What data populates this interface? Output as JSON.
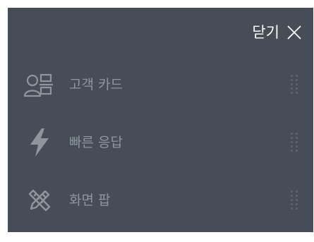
{
  "header": {
    "close_label": "닫기"
  },
  "menu": {
    "items": [
      {
        "label": "고객 카드",
        "icon": "customer-card-icon"
      },
      {
        "label": "빠른 응답",
        "icon": "lightning-icon"
      },
      {
        "label": "화면 팝",
        "icon": "screen-pop-icon"
      }
    ]
  },
  "colors": {
    "panel_background": "#464d57",
    "close_text": "#ffffff",
    "item_text": "#8f959d",
    "icon": "#8f959d",
    "drag_handle": "#59606a"
  },
  "icons": {
    "close": "close-icon",
    "drag": "drag-handle-icon"
  }
}
